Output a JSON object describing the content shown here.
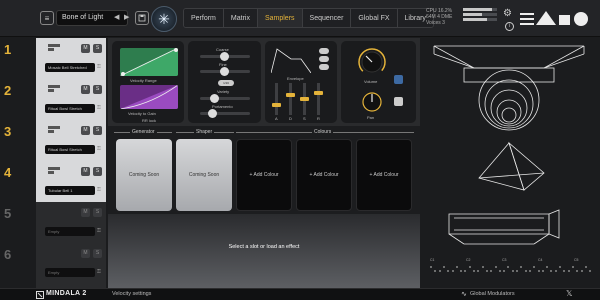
{
  "header": {
    "preset_name": "Bone of Light",
    "prev_label": "◀",
    "next_label": "▶",
    "tabs": [
      {
        "label": "Perform",
        "active": false
      },
      {
        "label": "Matrix",
        "active": false
      },
      {
        "label": "Samplers",
        "active": true
      },
      {
        "label": "Sequencer",
        "active": false
      },
      {
        "label": "Global FX",
        "active": false
      },
      {
        "label": "Library",
        "active": false
      }
    ],
    "stats": [
      "CPU 16.2%",
      "64M 4 DME",
      "Voices 3"
    ],
    "meters": [
      0.85,
      0.55,
      0.7
    ],
    "accent_color": "#e4b33a"
  },
  "slots": [
    {
      "number": "1",
      "name": "Mosaic Bell Stretched",
      "m": "M",
      "s": "S",
      "state": "filled",
      "highlight": true
    },
    {
      "number": "2",
      "name": "Ritual Bowl Stretch",
      "m": "M",
      "s": "S",
      "state": "filled",
      "highlight": true
    },
    {
      "number": "3",
      "name": "Ritual Bowl Stretch",
      "m": "M",
      "s": "S",
      "state": "filled",
      "highlight": true
    },
    {
      "number": "4",
      "name": "Tubular Bell 1",
      "m": "M",
      "s": "S",
      "state": "filled",
      "highlight": true
    },
    {
      "number": "5",
      "name": "Empty",
      "m": "M",
      "s": "S",
      "state": "empty",
      "highlight": false
    },
    {
      "number": "6",
      "name": "Empty",
      "m": "M",
      "s": "S",
      "state": "empty",
      "highlight": false
    }
  ],
  "sampler": {
    "velocity_range_label": "Velocity Range",
    "velocity_to_gain_label": "Velocity to Gain",
    "rr_lock_label": "RR lock",
    "coarse_label": "Coarse",
    "fine_label": "Fine",
    "variety_label": "Variety",
    "portamento_label": "Portamento",
    "envelope_label": "Envelope",
    "adsr_labels": [
      "A",
      "D",
      "S",
      "R"
    ],
    "volume_label": "Volume",
    "pan_label": "Pan",
    "variety_value": "1/16",
    "coarse_value": 0.5,
    "fine_value": 0.5,
    "portamento_value": 0.3
  },
  "colours": {
    "generator_label": "Generator",
    "shaper_label": "Shaper",
    "colours_label": "Colours",
    "coming_soon": "Coming Soon",
    "add_colour": "+ Add Colour"
  },
  "fx": {
    "message": "Select a slot or load an effect"
  },
  "right": {
    "marker_labels": [
      "C1",
      "C2",
      "C3",
      "C4",
      "C5"
    ]
  },
  "footer": {
    "brand": "MINDALA 2",
    "status": "Velocity settings",
    "global_modulators": "Global Modulators"
  }
}
